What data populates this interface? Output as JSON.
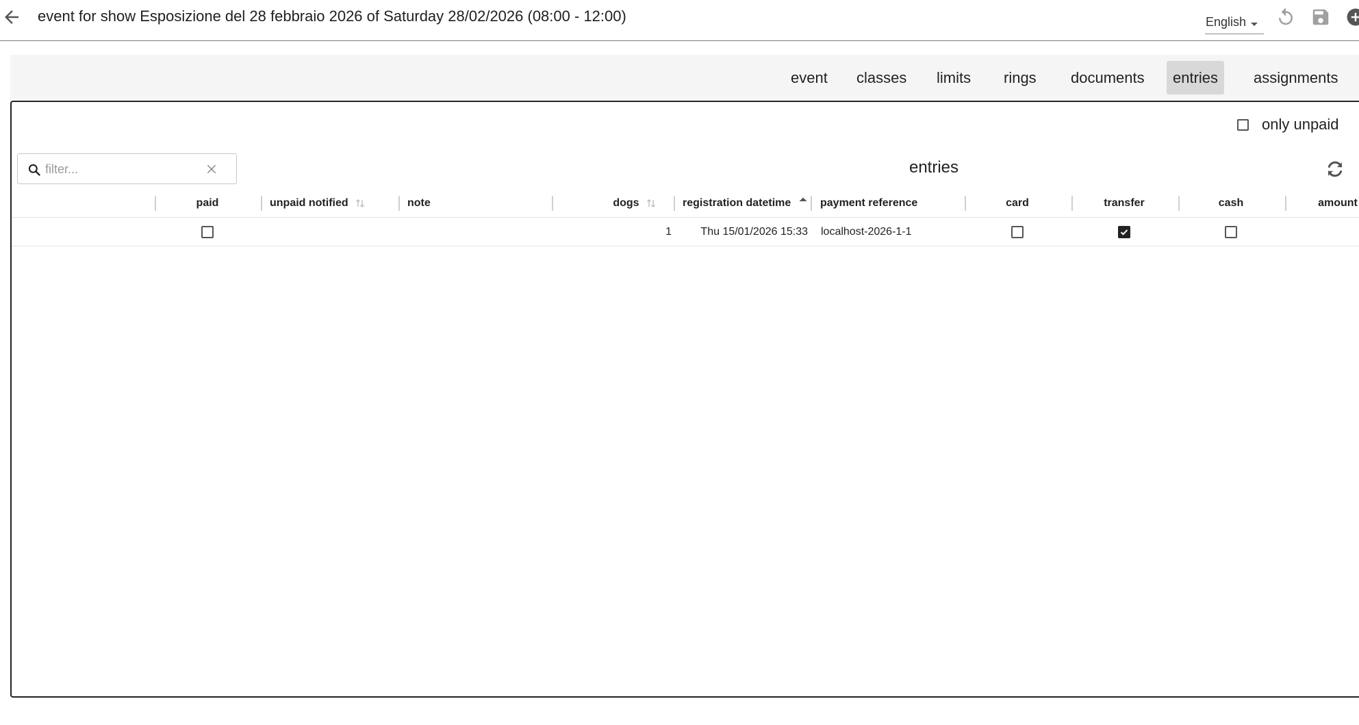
{
  "header": {
    "title": "event for show Esposizione del 28 febbraio 2026 of Saturday 28/02/2026 (08:00 - 12:00)",
    "language": "English",
    "icons": [
      "arrow-back-icon",
      "undo-icon",
      "save-icon",
      "add-circle-icon"
    ]
  },
  "tabs": [
    {
      "label": "event"
    },
    {
      "label": "classes"
    },
    {
      "label": "limits"
    },
    {
      "label": "rings"
    },
    {
      "label": "documents"
    },
    {
      "label": "entries",
      "active": true
    },
    {
      "label": "assignments"
    }
  ],
  "filters": {
    "only_unpaid_label": "only unpaid",
    "only_unpaid_checked": false,
    "search_placeholder": "filter...",
    "search_value": ""
  },
  "grid": {
    "title": "entries",
    "columns": [
      {
        "label": "paid"
      },
      {
        "label": "unpaid notified",
        "sort": "none"
      },
      {
        "label": "note"
      },
      {
        "label": "dogs",
        "sort": "none"
      },
      {
        "label": "registration datetime",
        "sort": "asc"
      },
      {
        "label": "payment reference"
      },
      {
        "label": "card"
      },
      {
        "label": "transfer"
      },
      {
        "label": "cash"
      },
      {
        "label": "amount"
      }
    ],
    "rows": [
      {
        "paid": false,
        "unpaid_notified": "",
        "note": "",
        "dogs": "1",
        "registration_datetime": "Thu 15/01/2026 15:33",
        "payment_reference": "localhost-2026-1-1",
        "card": false,
        "transfer": true,
        "cash": false,
        "amount": ""
      }
    ]
  },
  "colors": {
    "text": "#212121",
    "tabs_bar_bg": "#f5f5f5",
    "active_tab_bg": "#d8d8d8",
    "icon_gray": "#9e9e9e",
    "icon_dark": "#555555"
  }
}
